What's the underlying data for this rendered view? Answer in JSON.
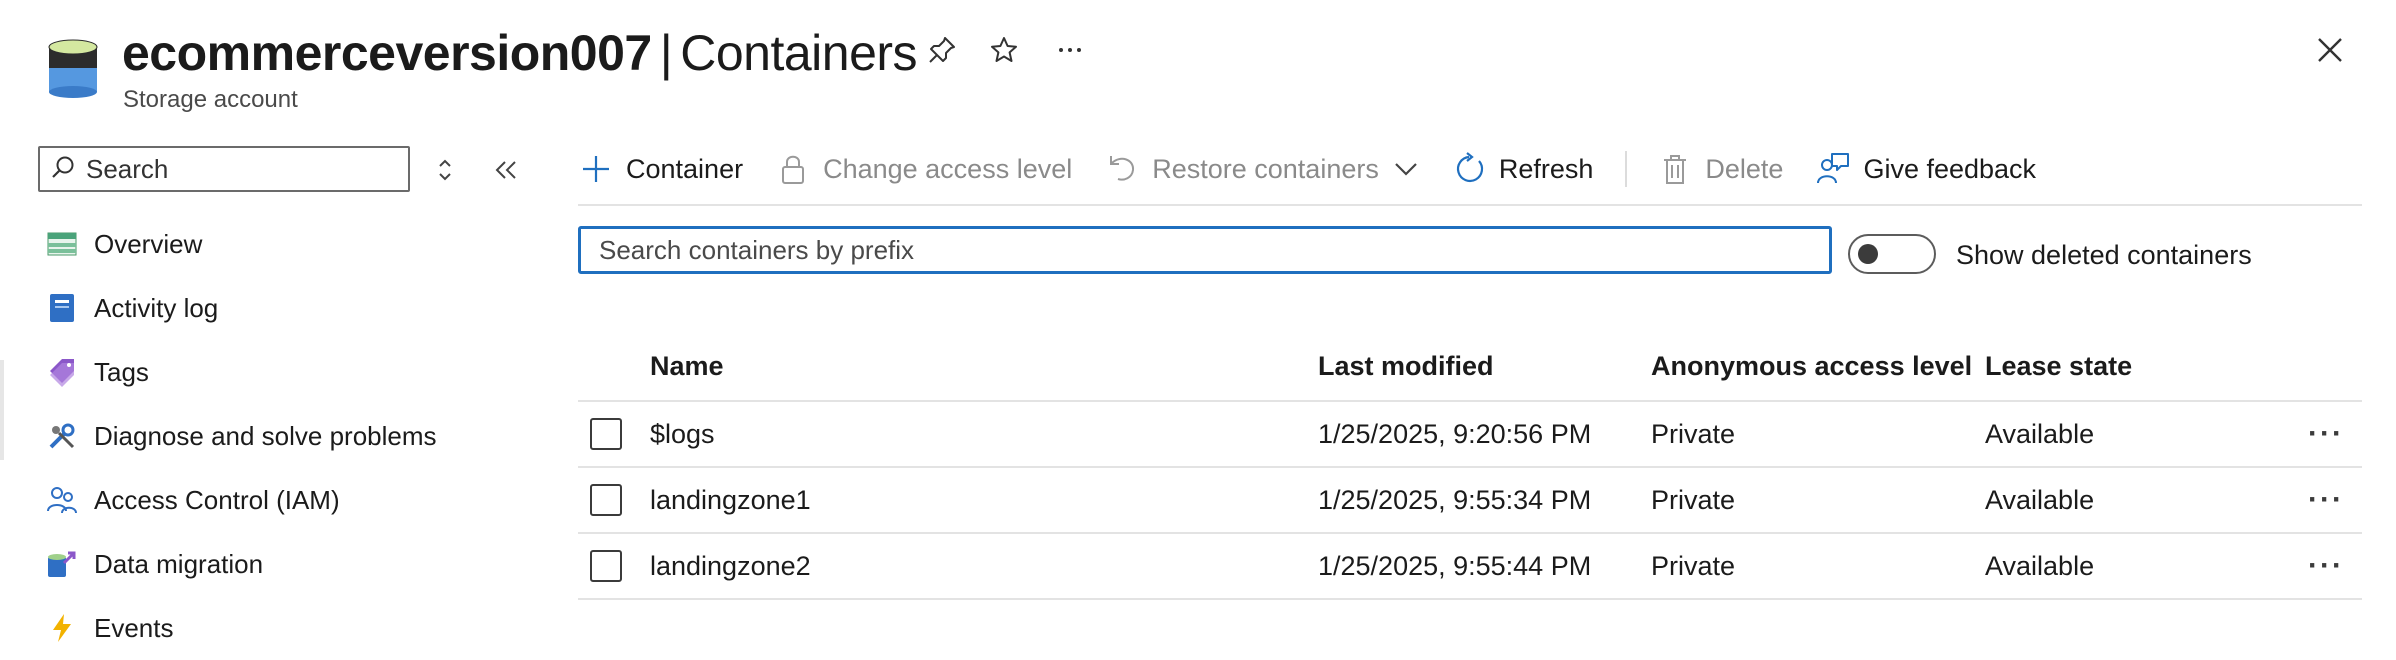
{
  "header": {
    "resource_name": "ecommerceversion007",
    "separator": "|",
    "page": "Containers",
    "resource_type": "Storage account",
    "icon": "storage-account-icon"
  },
  "sidebar": {
    "search_placeholder": "Search",
    "items": [
      {
        "label": "Overview",
        "icon": "overview-icon"
      },
      {
        "label": "Activity log",
        "icon": "activity-log-icon"
      },
      {
        "label": "Tags",
        "icon": "tag-icon"
      },
      {
        "label": "Diagnose and solve problems",
        "icon": "wrench-icon"
      },
      {
        "label": "Access Control (IAM)",
        "icon": "people-icon"
      },
      {
        "label": "Data migration",
        "icon": "data-migration-icon"
      },
      {
        "label": "Events",
        "icon": "lightning-icon"
      }
    ]
  },
  "toolbar": {
    "add_container": "Container",
    "change_access": "Change access level",
    "restore": "Restore containers",
    "refresh": "Refresh",
    "delete": "Delete",
    "feedback": "Give feedback"
  },
  "filter": {
    "placeholder": "Search containers by prefix",
    "toggle_label": "Show deleted containers",
    "toggle_on": false
  },
  "table": {
    "columns": [
      "Name",
      "Last modified",
      "Anonymous access level",
      "Lease state"
    ],
    "rows": [
      {
        "name": "$logs",
        "modified": "1/25/2025, 9:20:56 PM",
        "access": "Private",
        "lease": "Available"
      },
      {
        "name": "landingzone1",
        "modified": "1/25/2025, 9:55:34 PM",
        "access": "Private",
        "lease": "Available"
      },
      {
        "name": "landingzone2",
        "modified": "1/25/2025, 9:55:44 PM",
        "access": "Private",
        "lease": "Available"
      }
    ]
  },
  "colors": {
    "accent": "#1f6fbf",
    "text": "#1b1b1b",
    "disabled": "#8a8a8a"
  }
}
